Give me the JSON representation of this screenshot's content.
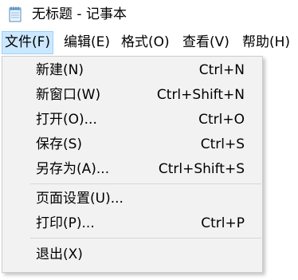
{
  "window": {
    "title": "无标题 - 记事本",
    "icon": "notepad-icon"
  },
  "menubar": {
    "items": [
      {
        "label": "文件(F)"
      },
      {
        "label": "编辑(E)"
      },
      {
        "label": "格式(O)"
      },
      {
        "label": "查看(V)"
      },
      {
        "label": "帮助(H)"
      }
    ],
    "active_index": 0
  },
  "file_menu": {
    "items": [
      {
        "label": "新建(N)",
        "shortcut": "Ctrl+N"
      },
      {
        "label": "新窗口(W)",
        "shortcut": "Ctrl+Shift+N"
      },
      {
        "label": "打开(O)...",
        "shortcut": "Ctrl+O"
      },
      {
        "label": "保存(S)",
        "shortcut": "Ctrl+S"
      },
      {
        "label": "另存为(A)...",
        "shortcut": "Ctrl+Shift+S"
      },
      {
        "label": "页面设置(U)...",
        "shortcut": ""
      },
      {
        "label": "打印(P)...",
        "shortcut": "Ctrl+P"
      },
      {
        "label": "退出(X)",
        "shortcut": ""
      }
    ]
  },
  "colors": {
    "menu_background": "#f2f2f2",
    "menubar_active_background": "#cce8ff",
    "menubar_active_border": "#99d1ff",
    "separator": "#d7d7d7"
  }
}
